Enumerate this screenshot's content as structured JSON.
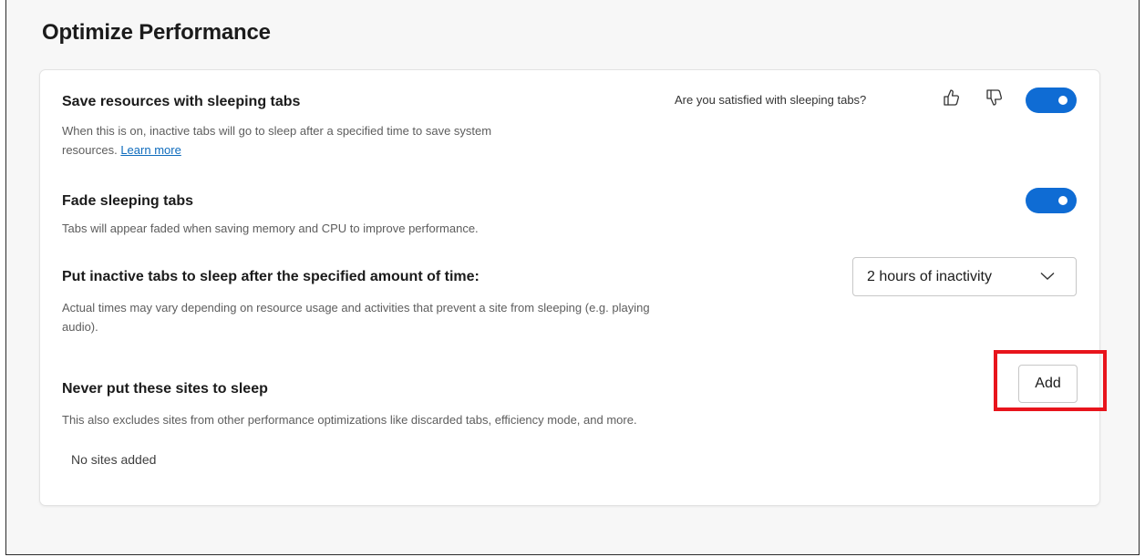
{
  "page": {
    "title": "Optimize Performance"
  },
  "sleeping_tabs": {
    "title": "Save resources with sleeping tabs",
    "description": "When this is on, inactive tabs will go to sleep after a specified time to save system resources.",
    "description_line1": "When this is on, inactive tabs will go to sleep after a specified time to save system",
    "description_line2": "resources.",
    "learn_more_label": "Learn more",
    "feedback_prompt": "Are you satisfied with sleeping tabs?",
    "thumbs_up_icon": "thumbs-up-icon",
    "thumbs_down_icon": "thumbs-down-icon",
    "enabled": true
  },
  "fade_tabs": {
    "title": "Fade sleeping tabs",
    "description": "Tabs will appear faded when saving memory and CPU to improve performance.",
    "enabled": true
  },
  "sleep_timeout": {
    "title": "Put inactive tabs to sleep after the specified amount of time:",
    "description_line1": "Actual times may vary depending on resource usage and activities that prevent a site from sleeping (e.g. playing",
    "description_line2": "audio).",
    "selected_value": "2 hours of inactivity"
  },
  "never_sleep": {
    "title": "Never put these sites to sleep",
    "description": "This also excludes sites from other performance optimizations like discarded tabs, efficiency mode, and more.",
    "add_label": "Add",
    "empty_text": "No sites added"
  },
  "colors": {
    "toggle_on": "#0f6cd4",
    "link": "#0f6cbd",
    "highlight_box": "#e8141c",
    "page_background": "#f7f7f7",
    "card_background": "#ffffff"
  }
}
